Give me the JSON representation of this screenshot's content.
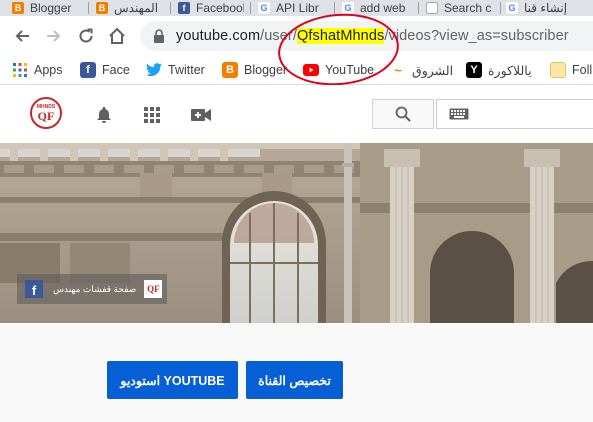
{
  "tabs": [
    {
      "label": "Blogger",
      "icon": "blogger-icon"
    },
    {
      "label": "المهندس",
      "icon": "blogger-icon"
    },
    {
      "label": "Facebook",
      "icon": "facebook-icon"
    },
    {
      "label": "API Libr",
      "icon": "google-icon"
    },
    {
      "label": "add web",
      "icon": "google-icon"
    },
    {
      "label": "Search c",
      "icon": "youtube-icon"
    },
    {
      "label": "إنشاء قنا",
      "icon": "google-icon"
    }
  ],
  "address_bar": {
    "host": "youtube.com",
    "path_prefix": "/user/",
    "channel_id": "QfshatMhnds",
    "path_suffix": "/videos?view_as=subscriber"
  },
  "bookmarks": [
    {
      "label": "Apps",
      "icon": "apps-grid-icon"
    },
    {
      "label": "Face",
      "icon": "facebook-icon"
    },
    {
      "label": "Twitter",
      "icon": "twitter-icon"
    },
    {
      "label": "Blogger",
      "icon": "blogger-icon"
    },
    {
      "label": "YouTube",
      "icon": "youtube-icon"
    },
    {
      "label": "الشروق",
      "icon": "shorouk-icon"
    },
    {
      "label": "ياللاكورة",
      "icon": "yallakora-icon"
    },
    {
      "label": "Foll",
      "icon": "folder-icon"
    }
  ],
  "youtube_header": {
    "channel_logo_top": "MHNDS",
    "channel_logo_mid": "QF"
  },
  "banner": {
    "links_text": "صفحة قفشات مهندس",
    "facebook_glyph": "f",
    "logo_glyph": "QF"
  },
  "actions": {
    "customize_label": "تخصيص القناة",
    "studio_label": "استوديو YOUTUBE"
  },
  "colors": {
    "youtube_blue": "#065fd4",
    "highlight": "#ffff00",
    "annotation_red": "#e0001b"
  }
}
